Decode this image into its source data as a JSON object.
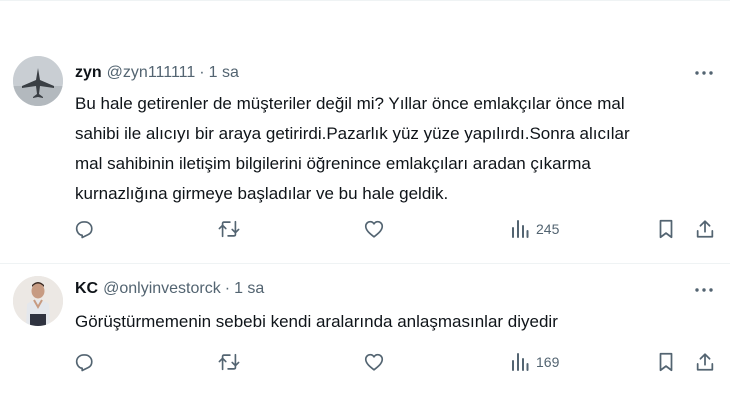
{
  "tweets": [
    {
      "name": "zyn",
      "handle": "@zyn111111",
      "separator": "·",
      "time": "1 sa",
      "text_lines": [
        "Bu hale getirenler de müşteriler değil mi? Yıllar önce emlakçılar önce mal",
        "sahibi ile alıcıyı bir araya getirirdi.Pazarlık yüz yüze yapılırdı.Sonra alıcılar",
        "mal sahibinin iletişim bilgilerini öğrenince emlakçıları aradan çıkarma",
        "kurnazlığına girmeye başladılar ve bu hale geldik."
      ],
      "views": "245"
    },
    {
      "name": "KC",
      "handle": "@onlyinvestorck",
      "separator": "·",
      "time": "1 sa",
      "text_lines": [
        "Görüştürmemenin sebebi kendi aralarında anlaşmasınlar diyedir"
      ],
      "views": "169"
    }
  ],
  "icons": {
    "more": "more-icon",
    "reply": "reply-icon",
    "repost": "repost-icon",
    "like": "like-icon",
    "views": "views-icon",
    "bookmark": "bookmark-icon",
    "share": "share-icon"
  },
  "colors": {
    "text": "#0f1419",
    "secondary": "#536471",
    "divider": "#eff3f4"
  }
}
